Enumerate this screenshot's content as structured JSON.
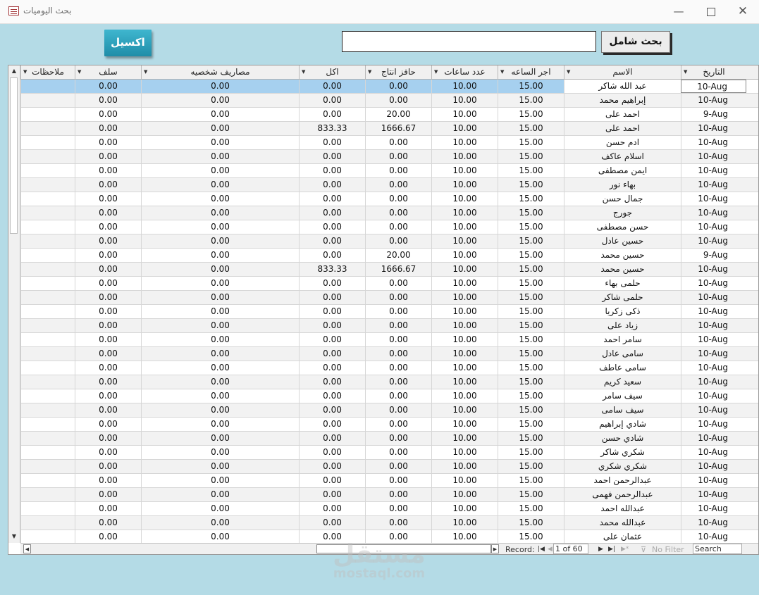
{
  "window": {
    "title": "بحث اليوميات",
    "minimize": "—",
    "close": "✕"
  },
  "toolbar": {
    "excel_label": "اكسيل",
    "search_button_label": "بحث شامل",
    "search_value": ""
  },
  "columns": [
    "التاريخ",
    "الاسم",
    "اجر الساعه",
    "عدد ساعات",
    "حافز انتاج",
    "اكل",
    "مصاريف شخصيه",
    "سلف",
    "ملاحظات"
  ],
  "rows": [
    [
      "10-Aug",
      "عبد الله شاكر",
      "15.00",
      "10.00",
      "0.00",
      "0.00",
      "0.00",
      "0.00",
      ""
    ],
    [
      "10-Aug",
      "إبراهيم محمد",
      "15.00",
      "10.00",
      "0.00",
      "0.00",
      "0.00",
      "0.00",
      ""
    ],
    [
      "9-Aug",
      "احمد على",
      "15.00",
      "10.00",
      "20.00",
      "0.00",
      "0.00",
      "0.00",
      ""
    ],
    [
      "10-Aug",
      "احمد على",
      "15.00",
      "10.00",
      "1666.67",
      "833.33",
      "0.00",
      "0.00",
      ""
    ],
    [
      "10-Aug",
      "ادم حسن",
      "15.00",
      "10.00",
      "0.00",
      "0.00",
      "0.00",
      "0.00",
      ""
    ],
    [
      "10-Aug",
      "اسلام عاكف",
      "15.00",
      "10.00",
      "0.00",
      "0.00",
      "0.00",
      "0.00",
      ""
    ],
    [
      "10-Aug",
      "ايمن مصطفى",
      "15.00",
      "10.00",
      "0.00",
      "0.00",
      "0.00",
      "0.00",
      ""
    ],
    [
      "10-Aug",
      "بهاء نور",
      "15.00",
      "10.00",
      "0.00",
      "0.00",
      "0.00",
      "0.00",
      ""
    ],
    [
      "10-Aug",
      "جمال حسن",
      "15.00",
      "10.00",
      "0.00",
      "0.00",
      "0.00",
      "0.00",
      ""
    ],
    [
      "10-Aug",
      "جورج",
      "15.00",
      "10.00",
      "0.00",
      "0.00",
      "0.00",
      "0.00",
      ""
    ],
    [
      "10-Aug",
      "حسن مصطفى",
      "15.00",
      "10.00",
      "0.00",
      "0.00",
      "0.00",
      "0.00",
      ""
    ],
    [
      "10-Aug",
      "حسين عادل",
      "15.00",
      "10.00",
      "0.00",
      "0.00",
      "0.00",
      "0.00",
      ""
    ],
    [
      "9-Aug",
      "حسين محمد",
      "15.00",
      "10.00",
      "20.00",
      "0.00",
      "0.00",
      "0.00",
      ""
    ],
    [
      "10-Aug",
      "حسين محمد",
      "15.00",
      "10.00",
      "1666.67",
      "833.33",
      "0.00",
      "0.00",
      ""
    ],
    [
      "10-Aug",
      "حلمى بهاء",
      "15.00",
      "10.00",
      "0.00",
      "0.00",
      "0.00",
      "0.00",
      ""
    ],
    [
      "10-Aug",
      "حلمى شاكر",
      "15.00",
      "10.00",
      "0.00",
      "0.00",
      "0.00",
      "0.00",
      ""
    ],
    [
      "10-Aug",
      "ذكى زكريا",
      "15.00",
      "10.00",
      "0.00",
      "0.00",
      "0.00",
      "0.00",
      ""
    ],
    [
      "10-Aug",
      "زياد على",
      "15.00",
      "10.00",
      "0.00",
      "0.00",
      "0.00",
      "0.00",
      ""
    ],
    [
      "10-Aug",
      "سامر احمد",
      "15.00",
      "10.00",
      "0.00",
      "0.00",
      "0.00",
      "0.00",
      ""
    ],
    [
      "10-Aug",
      "سامى عادل",
      "15.00",
      "10.00",
      "0.00",
      "0.00",
      "0.00",
      "0.00",
      ""
    ],
    [
      "10-Aug",
      "سامى عاطف",
      "15.00",
      "10.00",
      "0.00",
      "0.00",
      "0.00",
      "0.00",
      ""
    ],
    [
      "10-Aug",
      "سعيد كريم",
      "15.00",
      "10.00",
      "0.00",
      "0.00",
      "0.00",
      "0.00",
      ""
    ],
    [
      "10-Aug",
      "سيف سامر",
      "15.00",
      "10.00",
      "0.00",
      "0.00",
      "0.00",
      "0.00",
      ""
    ],
    [
      "10-Aug",
      "سيف سامى",
      "15.00",
      "10.00",
      "0.00",
      "0.00",
      "0.00",
      "0.00",
      ""
    ],
    [
      "10-Aug",
      "شادي إبراهيم",
      "15.00",
      "10.00",
      "0.00",
      "0.00",
      "0.00",
      "0.00",
      ""
    ],
    [
      "10-Aug",
      "شادي حسن",
      "15.00",
      "10.00",
      "0.00",
      "0.00",
      "0.00",
      "0.00",
      ""
    ],
    [
      "10-Aug",
      "شكري شاكر",
      "15.00",
      "10.00",
      "0.00",
      "0.00",
      "0.00",
      "0.00",
      ""
    ],
    [
      "10-Aug",
      "شكري شكري",
      "15.00",
      "10.00",
      "0.00",
      "0.00",
      "0.00",
      "0.00",
      ""
    ],
    [
      "10-Aug",
      "عبدالرحمن احمد",
      "15.00",
      "10.00",
      "0.00",
      "0.00",
      "0.00",
      "0.00",
      ""
    ],
    [
      "10-Aug",
      "عبدالرحمن فهمى",
      "15.00",
      "10.00",
      "0.00",
      "0.00",
      "0.00",
      "0.00",
      ""
    ],
    [
      "10-Aug",
      "عبدالله احمد",
      "15.00",
      "10.00",
      "0.00",
      "0.00",
      "0.00",
      "0.00",
      ""
    ],
    [
      "10-Aug",
      "عبدالله محمد",
      "15.00",
      "10.00",
      "0.00",
      "0.00",
      "0.00",
      "0.00",
      ""
    ],
    [
      "10-Aug",
      "عثمان على",
      "15.00",
      "10.00",
      "0.00",
      "0.00",
      "0.00",
      "0.00",
      ""
    ]
  ],
  "selected_row": 0,
  "nav": {
    "record_label": "Record:",
    "record_value": "1 of 60",
    "no_filter": "No Filter",
    "search": "Search"
  },
  "watermark": {
    "line1": "مستقل",
    "line2": "mostaql.com"
  }
}
